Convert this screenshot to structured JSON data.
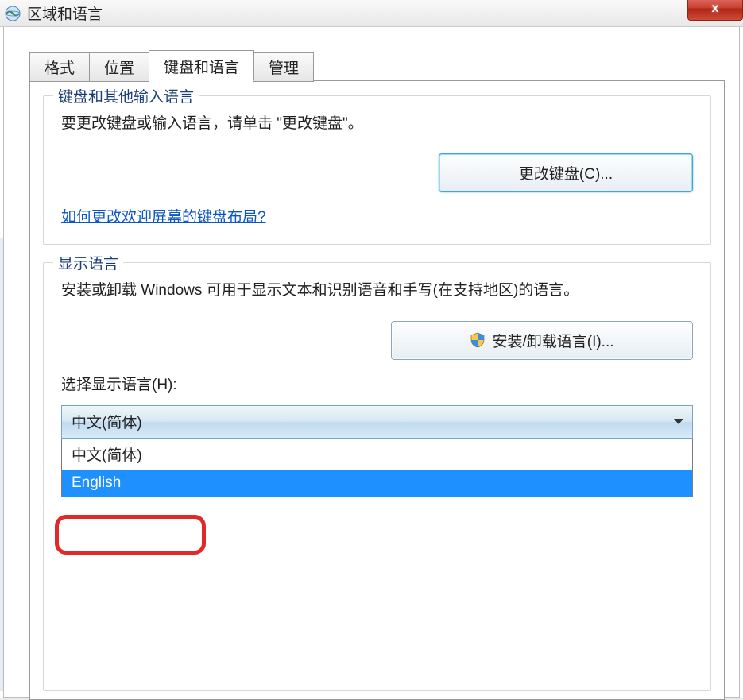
{
  "window": {
    "title": "区域和语言",
    "close_label": "x"
  },
  "tabs": [
    {
      "label": "格式",
      "active": false
    },
    {
      "label": "位置",
      "active": false
    },
    {
      "label": "键盘和语言",
      "active": true
    },
    {
      "label": "管理",
      "active": false
    }
  ],
  "group_keyboard": {
    "legend": "键盘和其他输入语言",
    "description": "要更改键盘或输入语言，请单击 \"更改键盘\"。",
    "change_button": "更改键盘(C)...",
    "help_link": "如何更改欢迎屏幕的键盘布局?"
  },
  "group_display": {
    "legend": "显示语言",
    "description": "安装或卸载 Windows 可用于显示文本和识别语音和手写(在支持地区)的语言。",
    "install_button": "安装/卸载语言(I)...",
    "select_label": "选择显示语言(H):",
    "selected_value": "中文(简体)",
    "options": [
      {
        "label": "中文(简体)",
        "selected": false
      },
      {
        "label": "English",
        "selected": true
      }
    ]
  }
}
